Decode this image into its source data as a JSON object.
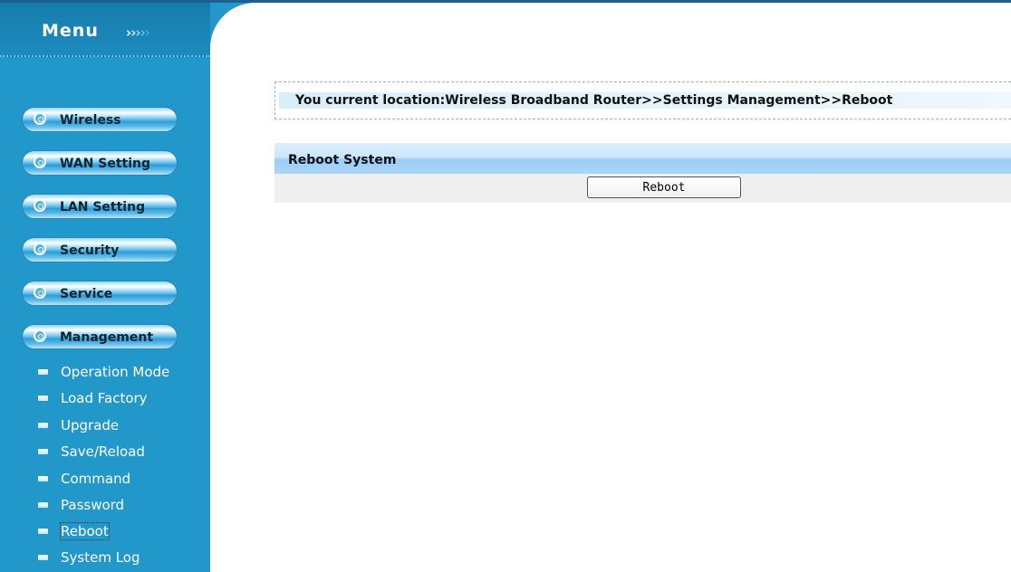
{
  "sidebar": {
    "title": "Menu",
    "arrows": [
      "›",
      "›",
      "›",
      "›",
      "›"
    ],
    "nav": [
      {
        "label": "Wireless",
        "icon": "circle-bullet-icon"
      },
      {
        "label": "WAN Setting",
        "icon": "circle-bullet-icon"
      },
      {
        "label": "LAN Setting",
        "icon": "circle-bullet-icon"
      },
      {
        "label": "Security",
        "icon": "circle-bullet-icon"
      },
      {
        "label": "Service",
        "icon": "circle-bullet-icon"
      },
      {
        "label": "Management",
        "icon": "circle-bullet-icon"
      }
    ],
    "sub_items": [
      {
        "label": "Operation Mode"
      },
      {
        "label": "Load Factory"
      },
      {
        "label": "Upgrade"
      },
      {
        "label": "Save/Reload"
      },
      {
        "label": "Command"
      },
      {
        "label": "Password"
      },
      {
        "label": "Reboot",
        "active": true
      },
      {
        "label": "System Log"
      }
    ]
  },
  "location": {
    "text": "You current location:Wireless Broadband Router>>Settings Management>>Reboot"
  },
  "section": {
    "title": "Reboot System",
    "button_label": "Reboot"
  },
  "colors": {
    "sidebar_bg": "#2297c9",
    "header_bg": "#167cac",
    "section_header": "#a9d5f8"
  }
}
